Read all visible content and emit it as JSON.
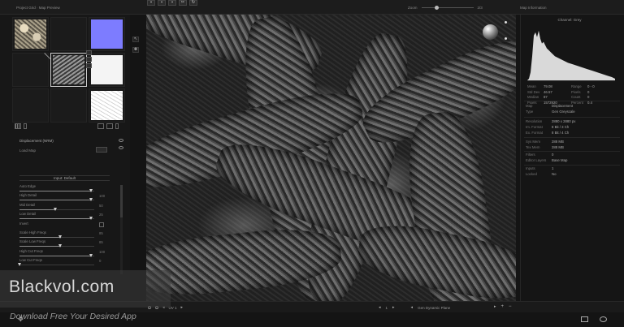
{
  "app": {
    "breadcrumb": [
      "Project Grid",
      "Map Preview"
    ],
    "toolbar_buttons": [
      {
        "icon": "save-icon",
        "glyph": "▪"
      },
      {
        "icon": "save-as-icon",
        "glyph": "▪"
      },
      {
        "icon": "export-icon",
        "glyph": "▪"
      },
      {
        "icon": "tools-icon",
        "glyph": "✂"
      },
      {
        "icon": "refresh-icon",
        "glyph": "↻"
      }
    ],
    "zoom": {
      "label": "Zoom",
      "value": "2/3",
      "level": 0.25
    }
  },
  "tiles": [
    {
      "name": "map-tile-diffuse",
      "kind": "rope",
      "selected": false
    },
    {
      "name": "map-tile-empty-1",
      "kind": "empty",
      "selected": false
    },
    {
      "name": "map-tile-normal",
      "kind": "normal",
      "selected": false
    },
    {
      "name": "map-tile-empty-2",
      "kind": "empty",
      "selected": false
    },
    {
      "name": "map-tile-displacement",
      "kind": "dark",
      "selected": true
    },
    {
      "name": "map-tile-specular",
      "kind": "white",
      "selected": false
    },
    {
      "name": "map-tile-empty-3",
      "kind": "empty",
      "selected": false
    },
    {
      "name": "map-tile-empty-4",
      "kind": "empty",
      "selected": false
    },
    {
      "name": "map-tile-occlusion",
      "kind": "light",
      "selected": false
    }
  ],
  "left_panel": {
    "param_title": "Displacement (NRM)",
    "param_sub": "Load Map",
    "preset_label": "Input: Default",
    "params": [
      {
        "label": "Auto Edge",
        "value": "",
        "level": 0.96,
        "type": "slider"
      },
      {
        "label": "High Detail",
        "value": "100",
        "level": 0.96,
        "type": "slider"
      },
      {
        "label": "Mid Detail",
        "value": "50",
        "level": 0.48,
        "type": "slider"
      },
      {
        "label": "Low Detail",
        "value": "25",
        "level": 0.96,
        "type": "slider"
      },
      {
        "label": "Invert",
        "value": "",
        "level": 0,
        "type": "check"
      },
      {
        "label": "Scale High Freqs",
        "value": "85",
        "level": 0.55,
        "type": "slider"
      },
      {
        "label": "Scale Low Freqs",
        "value": "85",
        "level": 0.55,
        "type": "slider"
      },
      {
        "label": "High Cut Freqs",
        "value": "100",
        "level": 0.96,
        "type": "slider"
      },
      {
        "label": "Low Cut Freqs",
        "value": "0",
        "level": 0.0,
        "type": "slider"
      }
    ]
  },
  "right_panel": {
    "title": "Map Information",
    "hist_title": "Channel: Grey",
    "stats": [
      {
        "k": "Mean",
        "v": "79.08",
        "k2": "Range",
        "v2": "0 - 0"
      },
      {
        "k": "Std Dev",
        "v": "46.57",
        "k2": "Pixels",
        "v2": "0"
      },
      {
        "k": "Median",
        "v": "87",
        "k2": "Count",
        "v2": "0"
      },
      {
        "k": "Pixels",
        "v": "1572920",
        "k2": "Percent",
        "v2": "0.4"
      }
    ],
    "info1": [
      {
        "k": "Map",
        "v": "Displacement"
      },
      {
        "k": "Type",
        "v": "Gen Greyscale"
      }
    ],
    "info2": [
      {
        "k": "Resolution",
        "v": "2880 x 2880 px"
      },
      {
        "k": "Im. Format",
        "v": "8 Bit / 3 Ch"
      },
      {
        "k": "Ex. Format",
        "v": "8 Bit / 4 Ch"
      }
    ],
    "info3": [
      {
        "k": "Sys Mem",
        "v": "288 MB"
      },
      {
        "k": "Tex Mem",
        "v": "288 MB"
      }
    ],
    "info4": [
      {
        "k": "Filters",
        "v": "0"
      },
      {
        "k": "Editor Layers",
        "v": "Base Map"
      }
    ],
    "info5": [
      {
        "k": "Inputs",
        "v": "1"
      },
      {
        "k": "Locked",
        "v": "No"
      }
    ]
  },
  "bottom_bar": {
    "uv_label": "UV 1",
    "page_label": "1",
    "preview_label": "Gen Dynamic Plane",
    "add_glyph": "+",
    "minus_glyph": "−"
  },
  "watermark": {
    "title": "Blackvol.com",
    "subtitle": "Download Free Your Desired App"
  },
  "colors": {
    "accent": "#cfcfcf",
    "panel_bg": "#171717",
    "app_bg": "#141414",
    "normal_map": "#7d7cff"
  }
}
